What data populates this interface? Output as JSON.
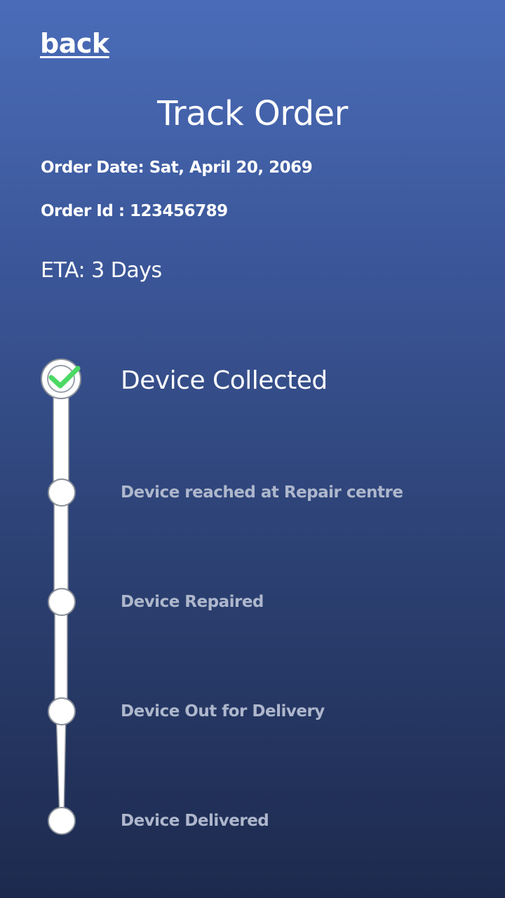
{
  "header": {
    "back_label": "back",
    "title": "Track Order"
  },
  "order": {
    "date_text": "Order Date: Sat, April 20, 2069",
    "id_text": "Order Id : 123456789",
    "eta_text": "ETA: 3 Days"
  },
  "timeline": {
    "steps": [
      {
        "label": "Device Collected",
        "status": "completed"
      },
      {
        "label": "Device reached at Repair centre",
        "status": "pending"
      },
      {
        "label": "Device Repaired",
        "status": "pending"
      },
      {
        "label": "Device Out for Delivery",
        "status": "pending"
      },
      {
        "label": "Device Delivered",
        "status": "pending"
      }
    ]
  },
  "colors": {
    "check": "#4cd964",
    "pending_text": "#aeb7cc",
    "active_text": "#ffffff"
  }
}
